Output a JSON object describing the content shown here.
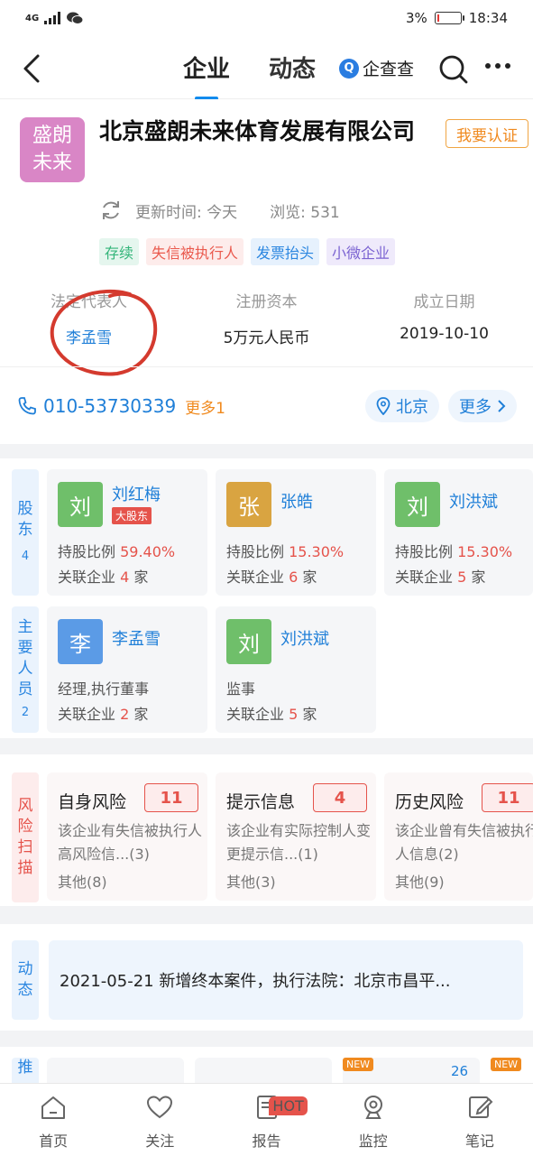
{
  "status": {
    "network": "4G",
    "battery_pct": "3%",
    "battery_level": 0.03,
    "time": "18:34"
  },
  "nav": {
    "tab_company": "企业",
    "tab_dynamic": "动态",
    "brand_logo": "Q",
    "brand_name": "企查查"
  },
  "company": {
    "logo_line1": "盛朗",
    "logo_line2": "未来",
    "name": "北京盛朗未来体育发展有限公司",
    "certify_button": "我要认证",
    "update_time": "更新时间: 今天",
    "views": "浏览: 531",
    "tags": [
      "存续",
      "失信被执行人",
      "发票抬头",
      "小微企业"
    ],
    "legal_rep_label": "法定代表人",
    "legal_rep": "李孟雪",
    "reg_capital_label": "注册资本",
    "reg_capital": "5万元人民币",
    "found_date_label": "成立日期",
    "found_date": "2019-10-10",
    "phone": "010-53730339",
    "phone_more": "更多1",
    "location": "北京",
    "more": "更多"
  },
  "shareholders": {
    "label": [
      "股",
      "东"
    ],
    "count": "4",
    "items": [
      {
        "avatar": "刘",
        "name": "刘红梅",
        "badge": "大股东",
        "ratio_label": "持股比例",
        "ratio": "59.40%",
        "related_label": "关联企业",
        "related": "4",
        "unit": "家",
        "color": "#6fbf6a"
      },
      {
        "avatar": "张",
        "name": "张皓",
        "ratio_label": "持股比例",
        "ratio": "15.30%",
        "related_label": "关联企业",
        "related": "6",
        "unit": "家",
        "color": "#d9a441"
      },
      {
        "avatar": "刘",
        "name": "刘洪斌",
        "ratio_label": "持股比例",
        "ratio": "15.30%",
        "related_label": "关联企业",
        "related": "5",
        "unit": "家",
        "color": "#6fbf6a"
      }
    ]
  },
  "staff": {
    "label": [
      "主",
      "要",
      "人",
      "员"
    ],
    "count": "2",
    "items": [
      {
        "avatar": "李",
        "name": "李孟雪",
        "role": "经理,执行董事",
        "related_label": "关联企业",
        "related": "2",
        "unit": "家",
        "color": "#5b9be6"
      },
      {
        "avatar": "刘",
        "name": "刘洪斌",
        "role": "监事",
        "related_label": "关联企业",
        "related": "5",
        "unit": "家",
        "color": "#6fbf6a"
      }
    ]
  },
  "risk": {
    "label": [
      "风",
      "险",
      "扫",
      "描"
    ],
    "items": [
      {
        "title": "自身风险",
        "count": "11",
        "desc": "该企业有失信被执行人高风险信...(3)",
        "other": "其他(8)"
      },
      {
        "title": "提示信息",
        "count": "4",
        "desc": "该企业有实际控制人变更提示信...(1)",
        "other": "其他(3)"
      },
      {
        "title": "历史风险",
        "count": "11",
        "desc": "该企业曾有失信被执行人信息(2)",
        "other": "其他(9)"
      }
    ]
  },
  "dynamic": {
    "label": [
      "动",
      "态"
    ],
    "text": "2021-05-21 新增终本案件，执行法院：北京市昌平..."
  },
  "recommend": {
    "label_first": "推",
    "new1": "NEW",
    "new2": "NEW",
    "number": "26"
  },
  "tabbar": [
    {
      "label": "首页",
      "icon": "home-icon"
    },
    {
      "label": "关注",
      "icon": "heart-icon"
    },
    {
      "label": "报告",
      "icon": "report-icon",
      "badge": "HOT"
    },
    {
      "label": "监控",
      "icon": "camera-icon"
    },
    {
      "label": "笔记",
      "icon": "note-icon"
    }
  ]
}
